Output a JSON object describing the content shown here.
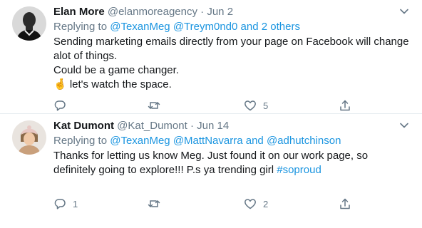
{
  "colors": {
    "text": "#14171a",
    "secondary": "#657786",
    "link": "#1b95e0",
    "border": "#e6ecf0"
  },
  "tweets": [
    {
      "name": "Elan More",
      "handle": "@elanmoreagency",
      "sep": "·",
      "date": "Jun 2",
      "replying_label": "Replying to",
      "mention_1": "@TexanMeg",
      "mention_2": "@Treym0nd0",
      "and_label": "and",
      "mention_3": "2 others",
      "body_line_1": "Sending marketing emails directly from your page on Facebook will change alot of things.",
      "body_line_2": "Could be a game changer.",
      "body_line_3": "🤞 let's watch the space.",
      "reply_count": "",
      "retweet_count": "",
      "like_count": "5",
      "icons": [
        "reply-icon",
        "retweet-icon",
        "like-icon",
        "share-icon",
        "chevron-down-icon"
      ]
    },
    {
      "name": "Kat Dumont",
      "handle": "@Kat_Dumont",
      "sep": "·",
      "date": "Jun 14",
      "replying_label": "Replying to",
      "mention_1": "@TexanMeg",
      "mention_2": "@MattNavarra",
      "and_label": "and",
      "mention_3": "@adhutchinson",
      "body_text": "Thanks for letting us know Meg. Just found it on our work page, so definitely going to explore!!! P.s ya trending girl ",
      "hashtag": "#soproud",
      "reply_count": "1",
      "retweet_count": "",
      "like_count": "2",
      "icons": [
        "reply-icon",
        "retweet-icon",
        "like-icon",
        "share-icon",
        "chevron-down-icon"
      ]
    }
  ]
}
